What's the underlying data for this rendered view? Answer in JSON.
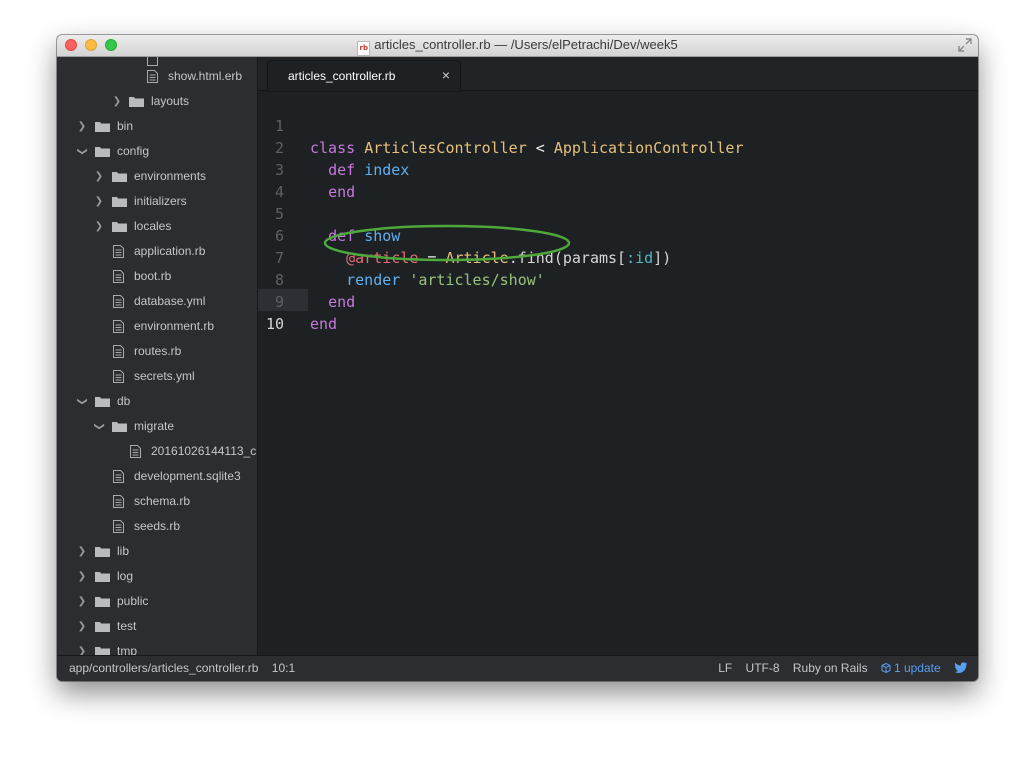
{
  "window": {
    "title_path": "articles_controller.rb — /Users/elPetrachi/Dev/week5",
    "file_icon_text": "rb"
  },
  "sidebar": {
    "items": [
      {
        "label": "show.html.erb"
      },
      {
        "label": "layouts"
      },
      {
        "label": "bin"
      },
      {
        "label": "config"
      },
      {
        "label": "environments"
      },
      {
        "label": "initializers"
      },
      {
        "label": "locales"
      },
      {
        "label": "application.rb"
      },
      {
        "label": "boot.rb"
      },
      {
        "label": "database.yml"
      },
      {
        "label": "environment.rb"
      },
      {
        "label": "routes.rb"
      },
      {
        "label": "secrets.yml"
      },
      {
        "label": "db"
      },
      {
        "label": "migrate"
      },
      {
        "label": "20161026144113_c"
      },
      {
        "label": "development.sqlite3"
      },
      {
        "label": "schema.rb"
      },
      {
        "label": "seeds.rb"
      },
      {
        "label": "lib"
      },
      {
        "label": "log"
      },
      {
        "label": "public"
      },
      {
        "label": "test"
      },
      {
        "label": "tmp"
      }
    ]
  },
  "tab": {
    "label": "articles_controller.rb",
    "close": "×"
  },
  "editor": {
    "line_numbers": [
      "1",
      "2",
      "3",
      "4",
      "5",
      "6",
      "7",
      "8",
      "9",
      "10"
    ],
    "line1": {
      "kw": "class",
      "cls": "ArticlesController",
      "op": "<",
      "parent": "ApplicationController"
    },
    "line2": {
      "kw": "def",
      "fn": "index"
    },
    "line3": {
      "kw": "end"
    },
    "line5": {
      "kw": "def",
      "fn": "show"
    },
    "line6": {
      "ivar": "@article",
      "op": "=",
      "cls": "Article",
      "call": ".find(params[",
      "sym": ":id",
      "close": "])"
    },
    "line7": {
      "fn": "render",
      "str": "'articles/show'"
    },
    "line8": {
      "kw": "end"
    },
    "line9": {
      "kw": "end"
    }
  },
  "statusbar": {
    "path": "app/controllers/articles_controller.rb",
    "cursor": "10:1",
    "line_ending": "LF",
    "encoding": "UTF-8",
    "grammar": "Ruby on Rails",
    "update": "1 update"
  },
  "colors": {
    "annotation_circle": "#4ea83a",
    "keyword": "#c678dd",
    "class_name": "#e5c07b",
    "function": "#61afef",
    "string": "#98c379",
    "instance_var": "#e06c75",
    "symbol": "#56b6c2"
  }
}
